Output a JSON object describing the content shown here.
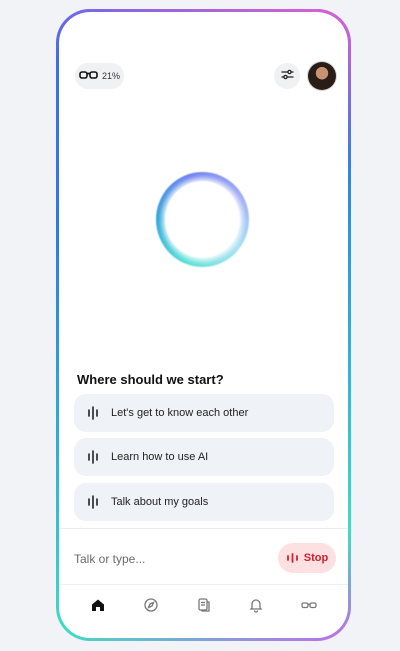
{
  "status": {
    "battery_label": "21%"
  },
  "heading": "Where should we start?",
  "suggestions": [
    {
      "label": "Let's get to know each other"
    },
    {
      "label": "Learn how to use AI"
    },
    {
      "label": "Talk about my goals"
    }
  ],
  "input": {
    "placeholder": "Talk or type...",
    "stop_label": "Stop"
  },
  "colors": {
    "stop_bg": "#fde1e2",
    "stop_text": "#d0202f",
    "suggestion_bg": "#eff2f6",
    "frame_gradient": [
      "#3a6cf0",
      "#3fdcc4",
      "#e15fd0"
    ]
  },
  "tabs": [
    {
      "name": "home-icon",
      "active": true
    },
    {
      "name": "compass-icon",
      "active": false
    },
    {
      "name": "notes-icon",
      "active": false
    },
    {
      "name": "bell-icon",
      "active": false
    },
    {
      "name": "glasses-icon",
      "active": false
    }
  ]
}
